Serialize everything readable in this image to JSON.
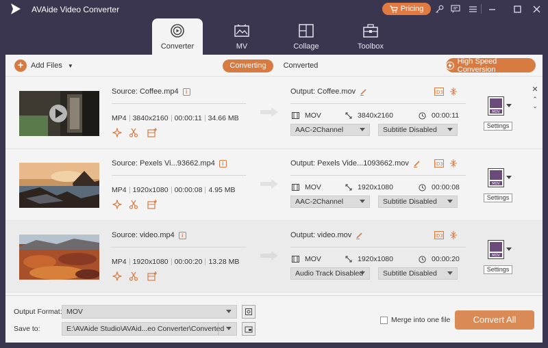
{
  "app": {
    "title": "AVAide Video Converter",
    "pricing_label": "Pricing"
  },
  "titlebar_icons": [
    "cart-icon",
    "key-icon",
    "chat-icon",
    "menu-icon",
    "minimize-icon",
    "maximize-icon",
    "close-icon"
  ],
  "tabs": [
    {
      "label": "Converter",
      "icon": "converter-icon",
      "active": true
    },
    {
      "label": "MV",
      "icon": "mv-icon",
      "active": false
    },
    {
      "label": "Collage",
      "icon": "collage-icon",
      "active": false
    },
    {
      "label": "Toolbox",
      "icon": "toolbox-icon",
      "active": false
    }
  ],
  "toolbar": {
    "add_files_label": "Add Files",
    "converting_label": "Converting",
    "converted_label": "Converted",
    "speed_label": "High Speed Conversion"
  },
  "files": [
    {
      "source": "Source: Coffee.mp4",
      "format": "MP4",
      "resolution": "3840x2160",
      "duration": "00:00:11",
      "size": "34.66 MB",
      "output": "Output: Coffee.mov",
      "out_format": "MOV",
      "out_resolution": "3840x2160",
      "out_duration": "00:00:11",
      "audio": "AAC-2Channel",
      "subtitle": "Subtitle Disabled",
      "settings_label": "Settings"
    },
    {
      "source": "Source: Pexels Vi...93662.mp4",
      "format": "MP4",
      "resolution": "1920x1080",
      "duration": "00:00:08",
      "size": "4.95 MB",
      "output": "Output: Pexels Vide...1093662.mov",
      "out_format": "MOV",
      "out_resolution": "1920x1080",
      "out_duration": "00:00:08",
      "audio": "AAC-2Channel",
      "subtitle": "Subtitle Disabled",
      "settings_label": "Settings"
    },
    {
      "source": "Source: video.mp4",
      "format": "MP4",
      "resolution": "1920x1080",
      "duration": "00:00:20",
      "size": "13.28 MB",
      "output": "Output: video.mov",
      "out_format": "MOV",
      "out_resolution": "1920x1080",
      "out_duration": "00:00:20",
      "audio": "Audio Track Disabled",
      "subtitle": "Subtitle Disabled",
      "settings_label": "Settings"
    }
  ],
  "format_badge": "MOV",
  "footer": {
    "output_format_label": "Output Format:",
    "output_format_value": "MOV",
    "save_to_label": "Save to:",
    "save_to_value": "E:\\AVAide Studio\\AVAid...eo Converter\\Converted",
    "merge_label": "Merge into one file",
    "convert_all_label": "Convert All"
  },
  "colors": {
    "accent": "#d77b42",
    "titlebar": "#3b3650",
    "panel": "#f4f4f4"
  }
}
